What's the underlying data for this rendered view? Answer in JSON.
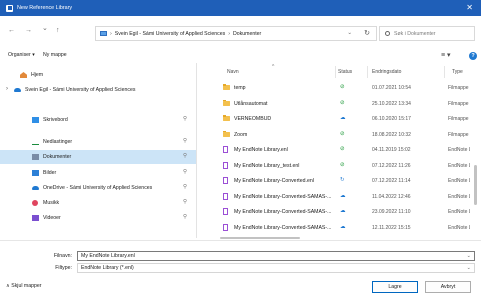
{
  "window": {
    "title": "New Reference Library",
    "close_glyph": "✕"
  },
  "nav": {
    "back_glyph": "←",
    "forward_glyph": "→",
    "recent_glyph": "⌄",
    "up_glyph": "↑",
    "breadcrumb": [
      "Svein Egil - Sámi University of Applied Sciences",
      "Dokumenter"
    ],
    "breadcrumb_sep": "›",
    "dropdown_glyph": "⌄",
    "refresh_glyph": "↻",
    "search_placeholder": "Søk i Dokumenter"
  },
  "toolbar": {
    "organize_label": "Organiser ▾",
    "new_folder_label": "Ny mappe",
    "view_glyph": "≡ ▾",
    "help_glyph": "?"
  },
  "sidebar": {
    "items": [
      {
        "label": "Hjem",
        "icon": "home-icon",
        "pinned": false,
        "expander": ""
      },
      {
        "label": "Svein Egil - Sámi University of Applied Sciences",
        "icon": "cloud-icon",
        "pinned": false,
        "expander": "›"
      },
      {
        "label": "Skrivebord",
        "icon": "desktop-icon",
        "pinned": true,
        "expander": ""
      },
      {
        "label": "Nedlastinger",
        "icon": "download-icon",
        "pinned": true,
        "expander": ""
      },
      {
        "label": "Dokumenter",
        "icon": "documents-icon",
        "pinned": true,
        "expander": "",
        "selected": true
      },
      {
        "label": "Bilder",
        "icon": "pictures-icon",
        "pinned": true,
        "expander": ""
      },
      {
        "label": "OneDrive - Sámi University of Applied Sciences",
        "icon": "cloud-icon",
        "pinned": true,
        "expander": ""
      },
      {
        "label": "Musikk",
        "icon": "music-icon",
        "pinned": true,
        "expander": ""
      },
      {
        "label": "Videoer",
        "icon": "videos-icon",
        "pinned": true,
        "expander": ""
      }
    ],
    "pin_glyph": "⚲"
  },
  "columns": {
    "name": "Navn",
    "status": "Status",
    "date": "Endringsdato",
    "type": "Type",
    "sort_glyph": "^"
  },
  "files": [
    {
      "name": "temp",
      "kind": "folder",
      "status": "synced",
      "status_glyph": "⊘",
      "date": "01.07.2021 10:54",
      "type": "Filmappe"
    },
    {
      "name": "Utlånsautomat",
      "kind": "folder",
      "status": "synced",
      "status_glyph": "⊘",
      "date": "25.10.2022 13:34",
      "type": "Filmappe"
    },
    {
      "name": "VERNEOMBUD",
      "kind": "folder",
      "status": "cloud",
      "status_glyph": "☁",
      "date": "06.10.2020 15:17",
      "type": "Filmappe"
    },
    {
      "name": "Zoom",
      "kind": "folder",
      "status": "synced",
      "status_glyph": "⊘",
      "date": "18.08.2022 10:32",
      "type": "Filmappe"
    },
    {
      "name": "My EndNote Library.enl",
      "kind": "doc",
      "status": "synced",
      "status_glyph": "⊘",
      "date": "04.11.2019 15:02",
      "type": "EndNote Library"
    },
    {
      "name": "My EndNote Library_test.enl",
      "kind": "doc",
      "status": "synced",
      "status_glyph": "⊘",
      "date": "07.12.2022 11:26",
      "type": "EndNote Library"
    },
    {
      "name": "My EndNote Library-Converted.enl",
      "kind": "doc",
      "status": "syncing",
      "status_glyph": "↻",
      "date": "07.12.2022 11:14",
      "type": "EndNote Library"
    },
    {
      "name": "My EndNote Library-Converted-SAMAS-...",
      "kind": "doc",
      "status": "cloud",
      "status_glyph": "☁",
      "date": "11.04.2022 12:46",
      "type": "EndNote Library"
    },
    {
      "name": "My EndNote Library-Converted-SAMAS-...",
      "kind": "doc",
      "status": "cloud",
      "status_glyph": "☁",
      "date": "23.09.2022 11:10",
      "type": "EndNote Library"
    },
    {
      "name": "My EndNote Library-Converted-SAMAS-...",
      "kind": "doc",
      "status": "cloud",
      "status_glyph": "☁",
      "date": "12.11.2022 15:15",
      "type": "EndNote Library"
    }
  ],
  "form": {
    "filename_label": "Filnavn:",
    "filename_value": "My EndNote Library.enl",
    "filetype_label": "Filtype:",
    "filetype_value": "EndNote Library (*.enl)",
    "dropdown_glyph": "⌄"
  },
  "footer": {
    "hide_folders_label": "∧  Skjul mapper",
    "save_label": "Lagre",
    "cancel_label": "Avbryt"
  },
  "colors": {
    "titlebar": "#1f5fb8",
    "selected_row": "#cce4f7",
    "synced": "#1f9a3a",
    "cloud": "#1f79d1",
    "accent": "#0067c0"
  }
}
